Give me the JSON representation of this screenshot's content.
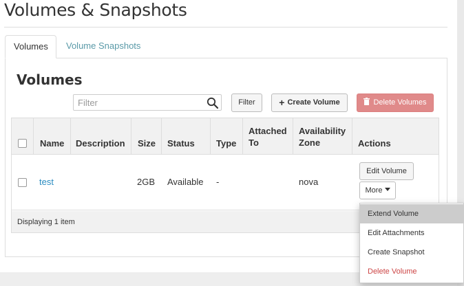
{
  "page": {
    "title": "Volumes & Snapshots"
  },
  "tabs": [
    {
      "label": "Volumes",
      "active": true
    },
    {
      "label": "Volume Snapshots",
      "active": false
    }
  ],
  "section": {
    "title": "Volumes"
  },
  "toolbar": {
    "filter_placeholder": "Filter",
    "filter_button": "Filter",
    "create_button": "Create Volume",
    "delete_button": "Delete Volumes"
  },
  "table": {
    "headers": {
      "name": "Name",
      "description": "Description",
      "size": "Size",
      "status": "Status",
      "type": "Type",
      "attached_to_1": "Attached",
      "attached_to_2": "To",
      "zone_1": "Availability",
      "zone_2": "Zone",
      "actions": "Actions"
    },
    "rows": [
      {
        "name": "test",
        "description": "",
        "size": "2GB",
        "status": "Available",
        "type": "-",
        "attached_to": "",
        "zone": "nova",
        "edit_button": "Edit Volume",
        "more_button": "More"
      }
    ],
    "footer": "Displaying 1 item"
  },
  "more_menu": {
    "items": [
      {
        "label": "Extend Volume",
        "hover": true
      },
      {
        "label": "Edit Attachments"
      },
      {
        "label": "Create Snapshot"
      },
      {
        "label": "Delete Volume",
        "danger": true
      }
    ]
  },
  "colors": {
    "link": "#2a8cc1",
    "danger_button": "#e08a8a",
    "danger_text": "#cc4444",
    "menu_hover": "#cccccc"
  }
}
